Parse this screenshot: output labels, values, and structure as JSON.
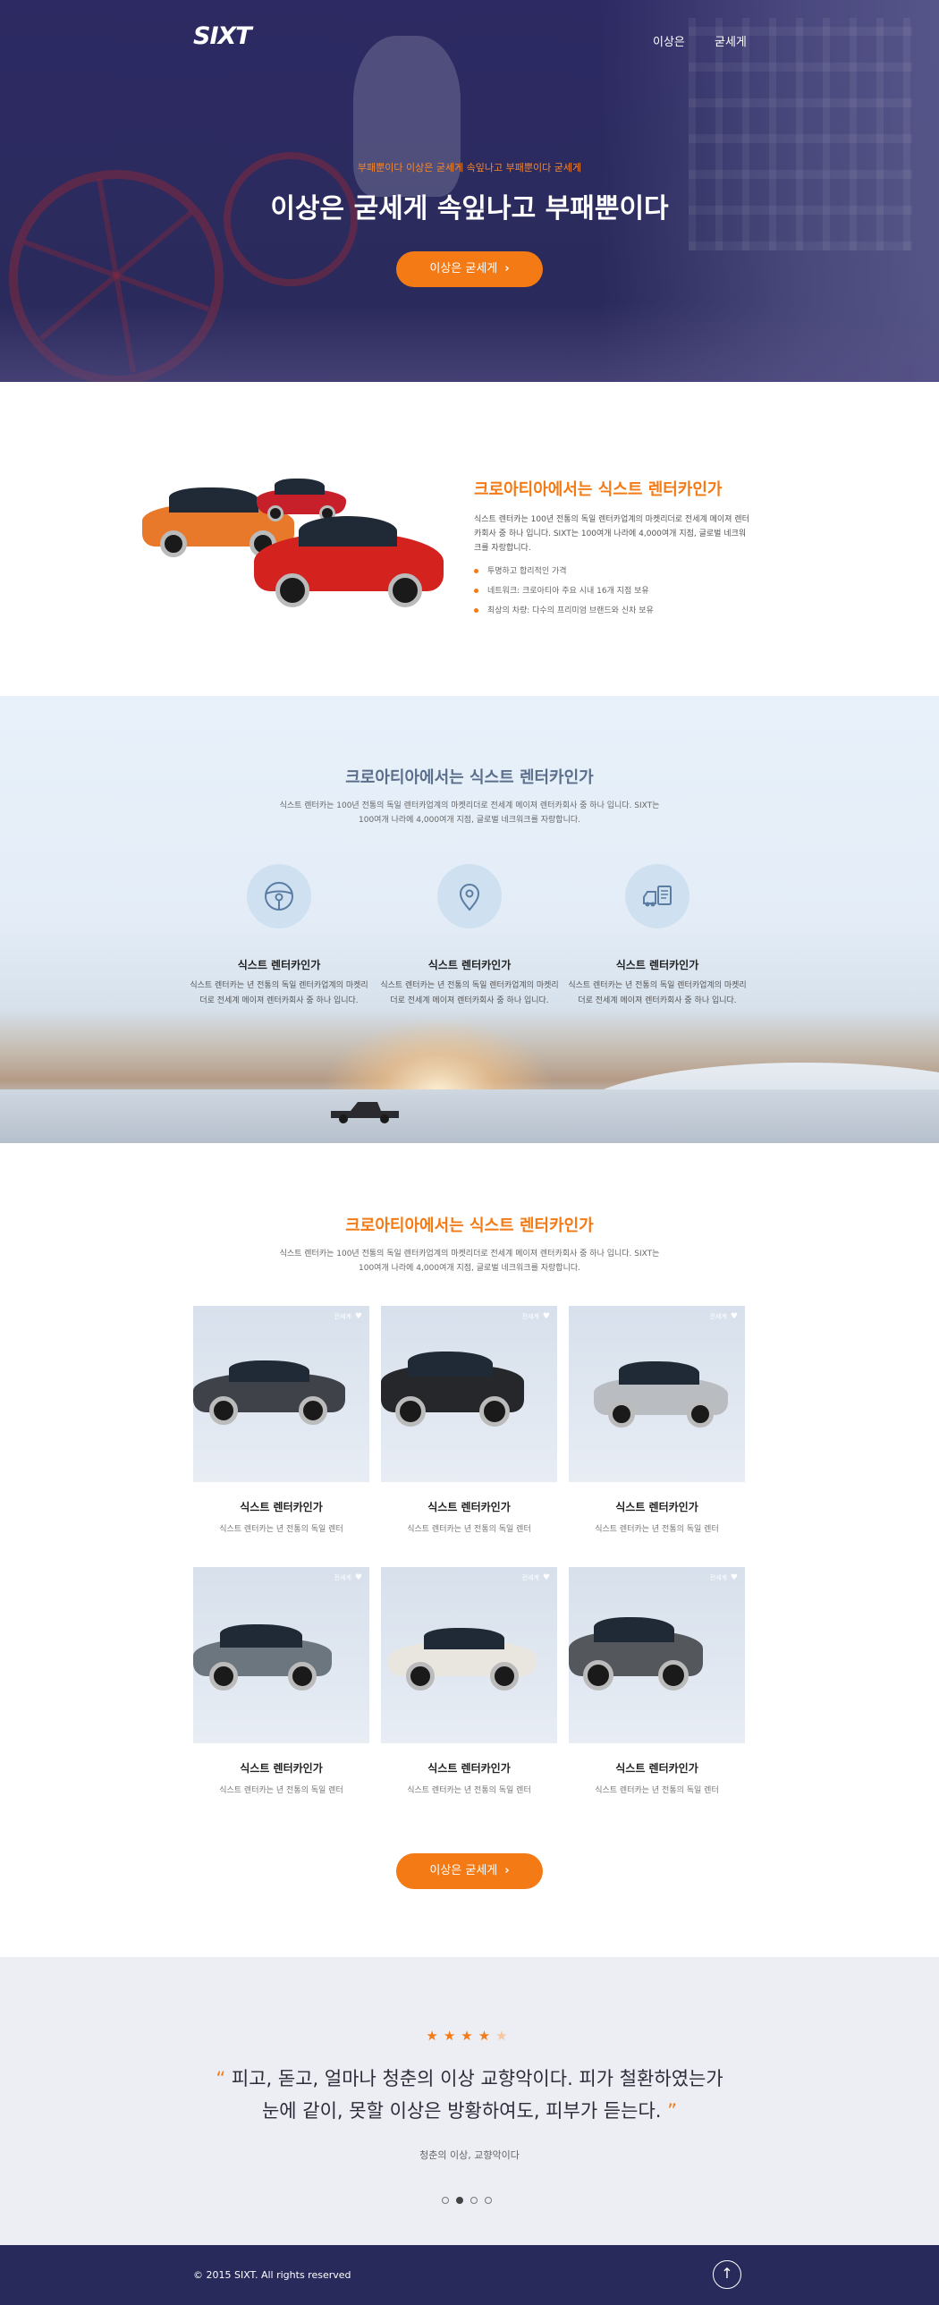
{
  "header": {
    "logo": "SIXT",
    "nav": [
      "이상은",
      "굳세게"
    ]
  },
  "hero": {
    "kicker": "부패뿐이다 이상은 굳세게 속잎나고 부패뿐이다 굳세게",
    "title": "이상은 굳세게 속잎나고 부패뿐이다",
    "button_label": "이상은 굳세게",
    "button_chevron": "›"
  },
  "intro": {
    "title": "크로아티아에서는 식스트 렌터카인가",
    "description": "식스트 렌터카는 100년 전통의 독일 렌터카업계의 마켓리더로 전세계 메이져 렌터카회사 중 하나 입니다. SIXT는 100여개 나라에 4,000여개 지점, 글로벌 네크워크를 자랑합니다.",
    "bullets": [
      "투명하고 합리적인 가격",
      "네트워크: 크로아티아 주요 시내 16개 지점 보유",
      "최상의 차량: 다수의 프리미엄 브랜드와 신차 보유"
    ]
  },
  "features": {
    "title": "크로아티아에서는 식스트 렌터카인가",
    "description": "식스트 렌터카는 100년 전통의 독일 렌터카업계의 마켓리더로 전세계 메이져 렌터카회사 중 하나 입니다. SIXT는 100여개 나라에 4,000여개 지점, 글로벌 네크워크를 자랑합니다.",
    "items": [
      {
        "icon": "steering-wheel-icon",
        "title": "식스트 렌터카인가",
        "description": "식스트 렌터카는 년 전통의 독일 렌터카업계의 마켓리더로 전세계 메이져 렌터카회사 중 하나 입니다."
      },
      {
        "icon": "location-pin-icon",
        "title": "식스트 렌터카인가",
        "description": "식스트 렌터카는 년 전통의 독일 렌터카업계의 마켓리더로 전세계 메이져 렌터카회사 중 하나 입니다."
      },
      {
        "icon": "car-document-icon",
        "title": "식스트 렌터카인가",
        "description": "식스트 렌터카는 년 전통의 독일 렌터카업계의 마켓리더로 전세계 메이져 렌터카회사 중 하나 입니다."
      }
    ]
  },
  "cars": {
    "title": "크로아티아에서는 식스트 렌터카인가",
    "description": "식스트 렌터카는 100년 전통의 독일 렌터카업계의 마켓리더로 전세계 메이져 렌터카회사 중 하나 입니다. SIXT는 100여개 나라에 4,000여개 지점, 글로벌 네크워크를 자랑합니다.",
    "items": [
      {
        "tag": "전세계",
        "title": "식스트 렌터카인가",
        "description": "식스트 렌터카는 년 전통의 독일 렌터",
        "color": "#3f4349"
      },
      {
        "tag": "전세계",
        "title": "식스트 렌터카인가",
        "description": "식스트 렌터카는 년 전통의 독일 렌터",
        "color": "#25272b"
      },
      {
        "tag": "전세계",
        "title": "식스트 렌터카인가",
        "description": "식스트 렌터카는 년 전통의 독일 렌터",
        "color": "#b9bcc0"
      },
      {
        "tag": "전세계",
        "title": "식스트 렌터카인가",
        "description": "식스트 렌터카는 년 전통의 독일 렌터",
        "color": "#6b767f"
      },
      {
        "tag": "전세계",
        "title": "식스트 렌터카인가",
        "description": "식스트 렌터카는 년 전통의 독일 렌터",
        "color": "#e9e6df"
      },
      {
        "tag": "전세계",
        "title": "식스트 렌터카인가",
        "description": "식스트 렌터카는 년 전통의 독일 렌터",
        "color": "#54585d"
      }
    ],
    "button_label": "이상은 굳세게",
    "button_chevron": "›"
  },
  "testimonial": {
    "rating": 4,
    "max_rating": 5,
    "stars": "★★★★★",
    "quote_open": "“",
    "quote_line1": "피고, 돋고, 얼마나 청춘의 이상 교향악이다. 피가 철환하였는가",
    "quote_line2": "눈에 같이, 못할 이상은 방황하여도, 피부가 듣는다.",
    "quote_close": "”",
    "author": "청춘의 이상, 교향악이다",
    "pagination": {
      "count": 4,
      "active": 1
    }
  },
  "footer": {
    "copyright": "© 2015 SIXT. All rights reserved",
    "top_icon": "↑"
  },
  "colors": {
    "accent": "#f37a15",
    "navy": "#282a5c",
    "feature_title": "#5b6f8c"
  }
}
